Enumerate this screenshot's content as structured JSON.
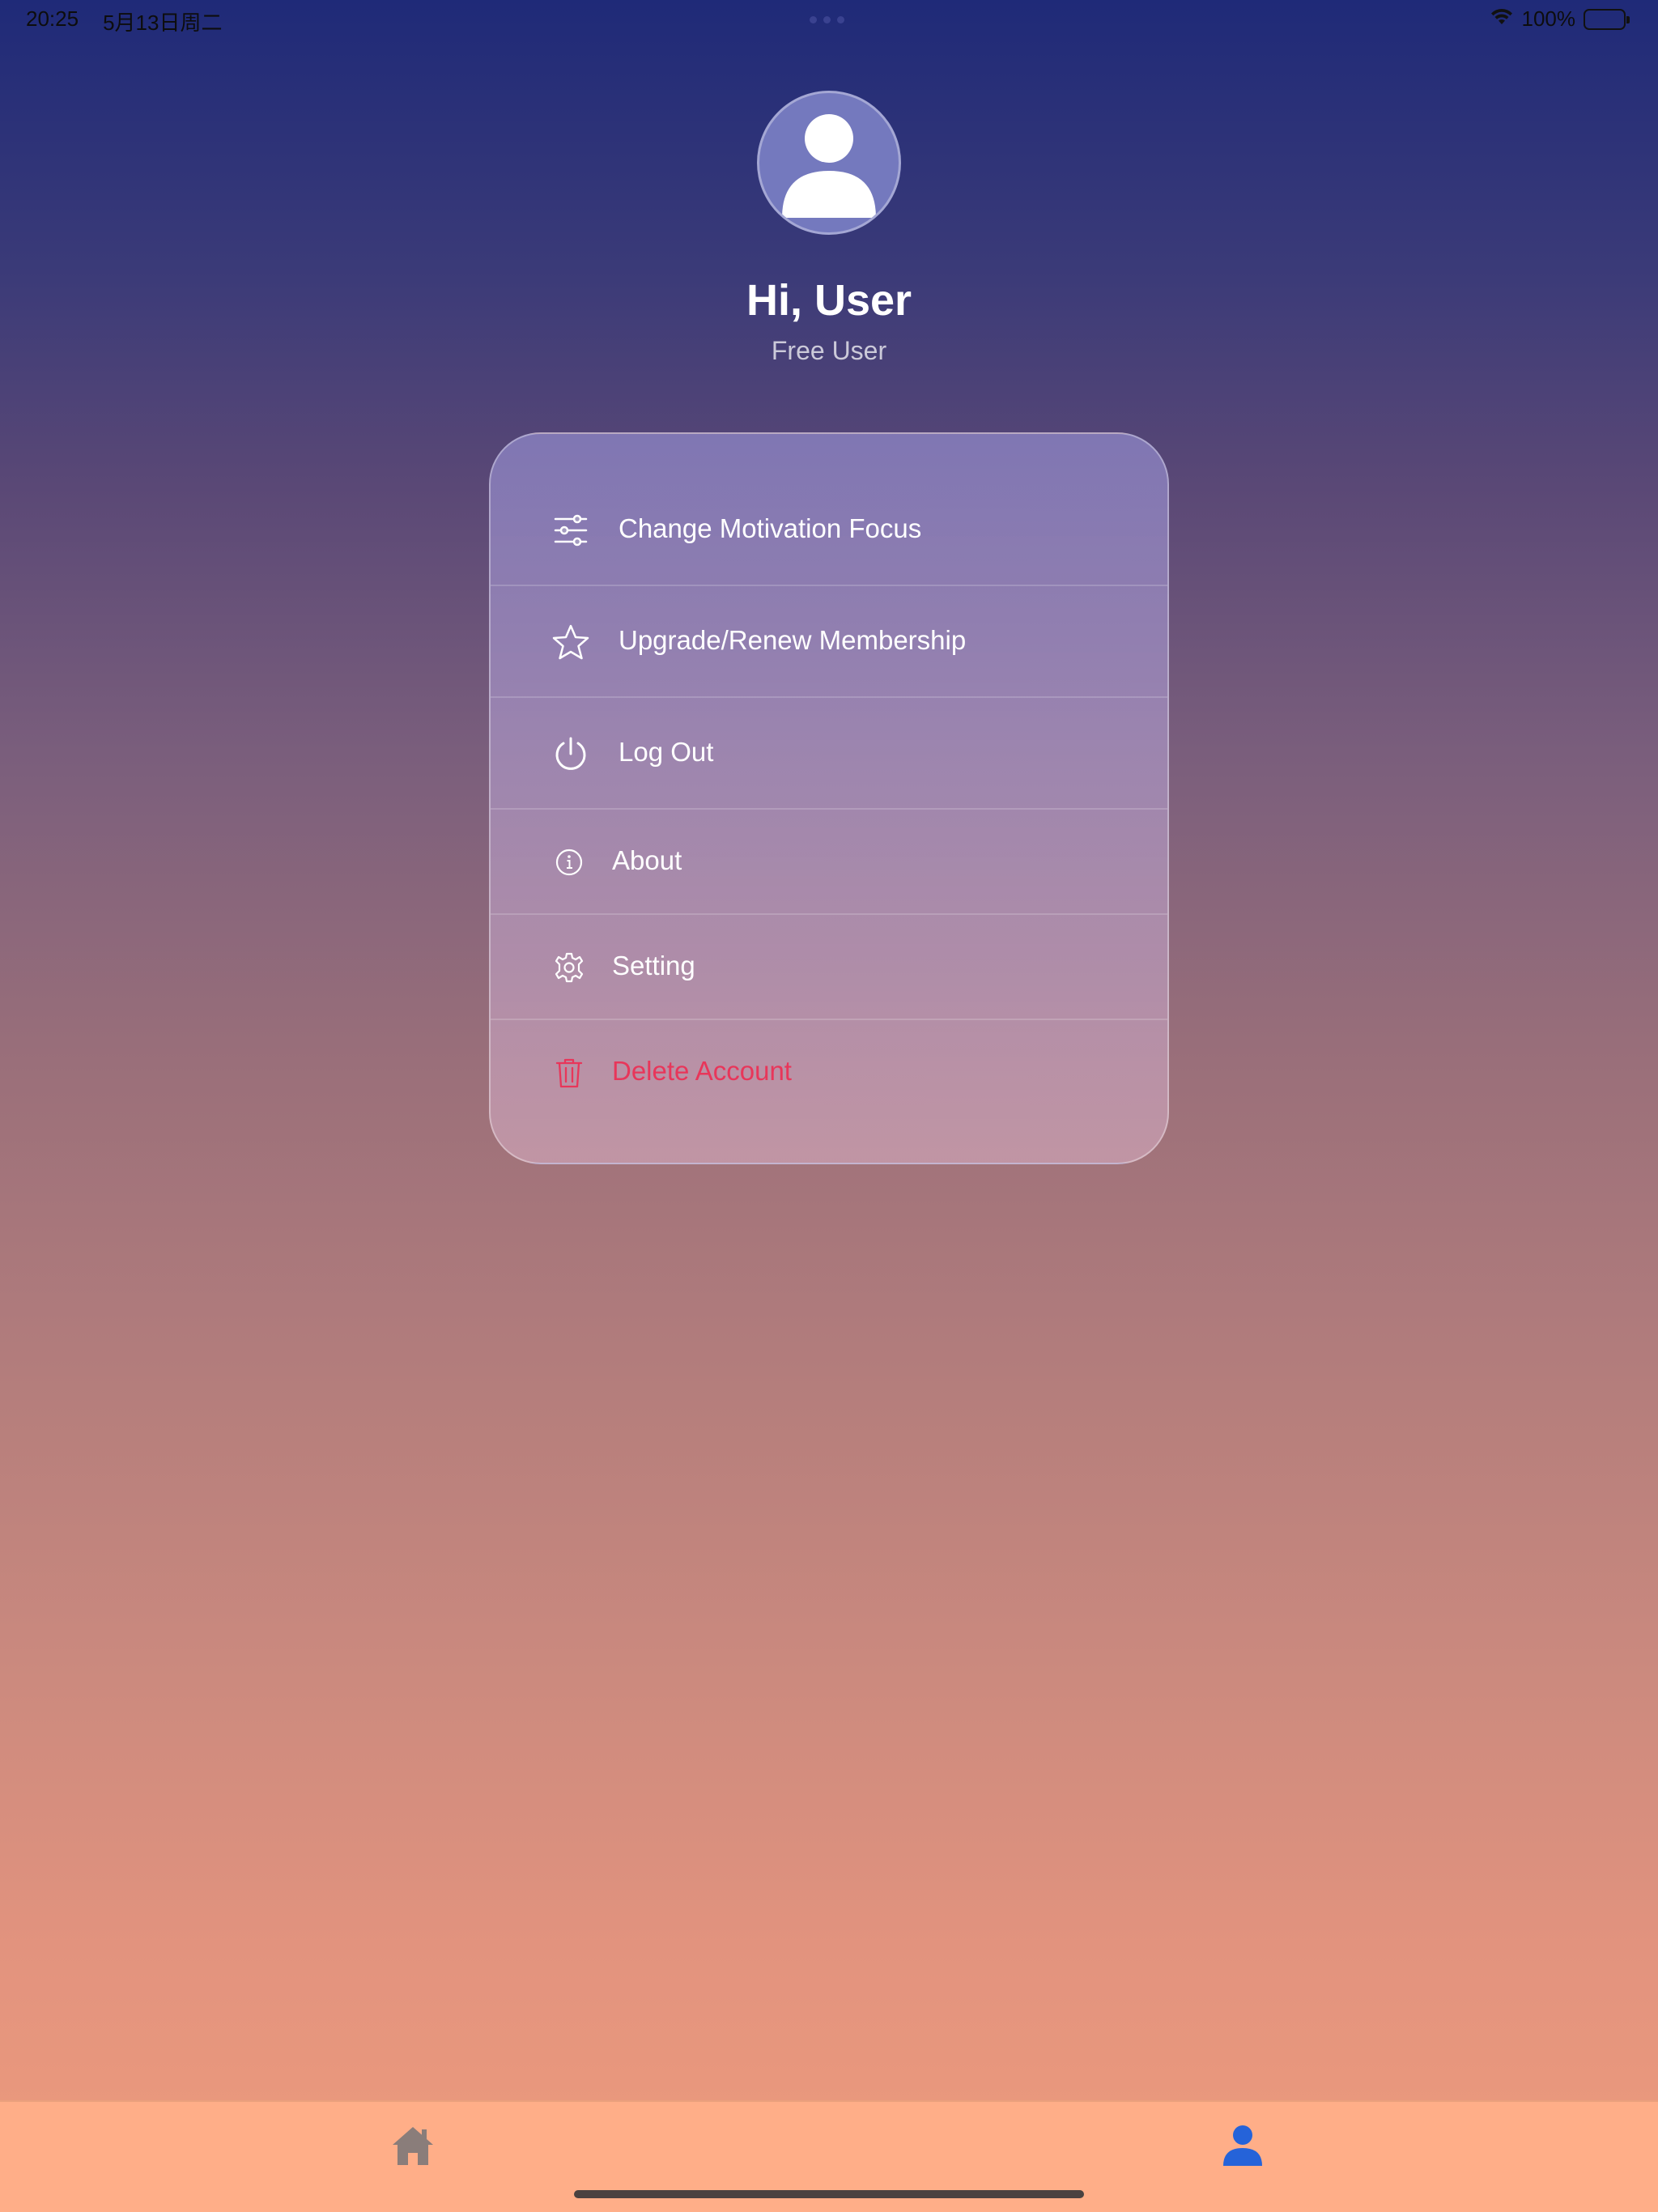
{
  "status_bar": {
    "time": "20:25",
    "date": "5月13日周二",
    "battery_percent": "100%",
    "battery_level": 100
  },
  "profile": {
    "greeting": "Hi, User",
    "membership": "Free User"
  },
  "menu": {
    "items": [
      {
        "label": "Change Motivation Focus",
        "icon": "sliders-icon"
      },
      {
        "label": "Upgrade/Renew Membership",
        "icon": "star-icon"
      },
      {
        "label": "Log Out",
        "icon": "power-icon"
      },
      {
        "label": "About",
        "icon": "info-icon"
      },
      {
        "label": "Setting",
        "icon": "gear-icon"
      },
      {
        "label": "Delete Account",
        "icon": "trash-icon"
      }
    ]
  },
  "tab_bar": {
    "tabs": [
      {
        "icon": "home-icon",
        "active": false
      },
      {
        "icon": "profile-icon",
        "active": true
      }
    ]
  },
  "colors": {
    "danger": "#e8365a",
    "active_tab": "#2563d9",
    "inactive_tab": "#8a7d7a",
    "tab_bar_bg": "#ffae88"
  }
}
